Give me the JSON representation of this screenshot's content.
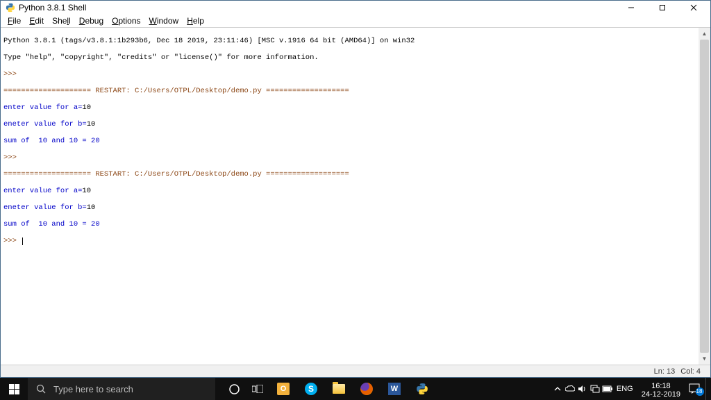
{
  "titlebar": {
    "title": "Python 3.8.1 Shell"
  },
  "menus": {
    "file": {
      "u": "F",
      "rest": "ile"
    },
    "edit": {
      "u": "E",
      "rest": "dit"
    },
    "shell": {
      "pre": "She",
      "u": "l",
      "rest": "l"
    },
    "debug": {
      "u": "D",
      "rest": "ebug"
    },
    "options": {
      "u": "O",
      "rest": "ptions"
    },
    "window": {
      "u": "W",
      "rest": "indow"
    },
    "help": {
      "u": "H",
      "rest": "elp"
    }
  },
  "shell": {
    "banner1": "Python 3.8.1 (tags/v3.8.1:1b293b6, Dec 18 2019, 23:11:46) [MSC v.1916 64 bit (AMD64)] on win32",
    "banner2": "Type \"help\", \"copyright\", \"credits\" or \"license()\" for more information.",
    "prompt": ">>> ",
    "restart_line": "==================== RESTART: C:/Users/OTPL/Desktop/demo.py ===================",
    "in_a_prompt": "enter value for a=",
    "in_a_val": "10",
    "in_b_prompt": "eneter value for b=",
    "in_b_val": "10",
    "sum_line": "sum of  10 and 10 = 20"
  },
  "status": {
    "ln_label": "Ln:",
    "ln": "13",
    "col_label": "Col:",
    "col": "4"
  },
  "taskbar": {
    "search_placeholder": "Type here to search",
    "lang": "ENG",
    "time": "16:18",
    "date": "24-12-2019",
    "notif_count": "18"
  }
}
